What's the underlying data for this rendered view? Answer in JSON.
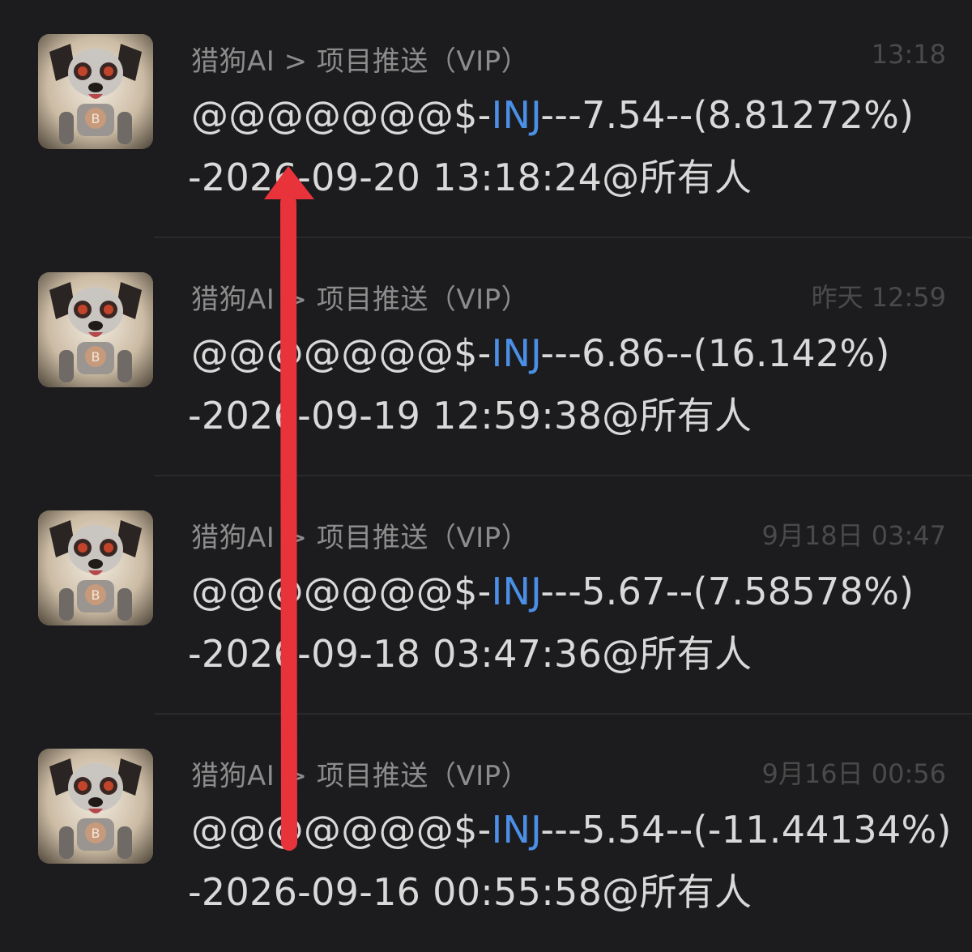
{
  "messages": [
    {
      "title": "猎狗AI > 项目推送（VIP）",
      "time": "13:18",
      "prefix": "@@@@@@@$-",
      "ticker": "INJ",
      "suffix": "---7.54--(8.81272%)",
      "line2": "-2026-09-20 13:18:24@所有人"
    },
    {
      "title": "猎狗AI > 项目推送（VIP）",
      "time": "昨天 12:59",
      "prefix": "@@@@@@@$-",
      "ticker": "INJ",
      "suffix": "---6.86--(16.142%)",
      "line2": "-2026-09-19 12:59:38@所有人"
    },
    {
      "title": "猎狗AI > 项目推送（VIP）",
      "time": "9月18日 03:47",
      "prefix": "@@@@@@@$-",
      "ticker": "INJ",
      "suffix": "---5.67--(7.58578%)",
      "line2": "-2026-09-18 03:47:36@所有人"
    },
    {
      "title": "猎狗AI > 项目推送（VIP）",
      "time": "9月16日 00:56",
      "prefix": "@@@@@@@$-",
      "ticker": "INJ",
      "suffix": "---5.54--(-11.44134%)",
      "line2": "-2026-09-16 00:55:58@所有人"
    }
  ],
  "colors": {
    "background": "#1c1c1e",
    "ticker": "#4b8fe6",
    "arrow": "#e8333a",
    "title": "#8c8c8c",
    "time": "#4a4a4a"
  },
  "icons": {
    "avatar": "robot-dog-avatar-icon",
    "annotation": "red-up-arrow-annotation"
  }
}
